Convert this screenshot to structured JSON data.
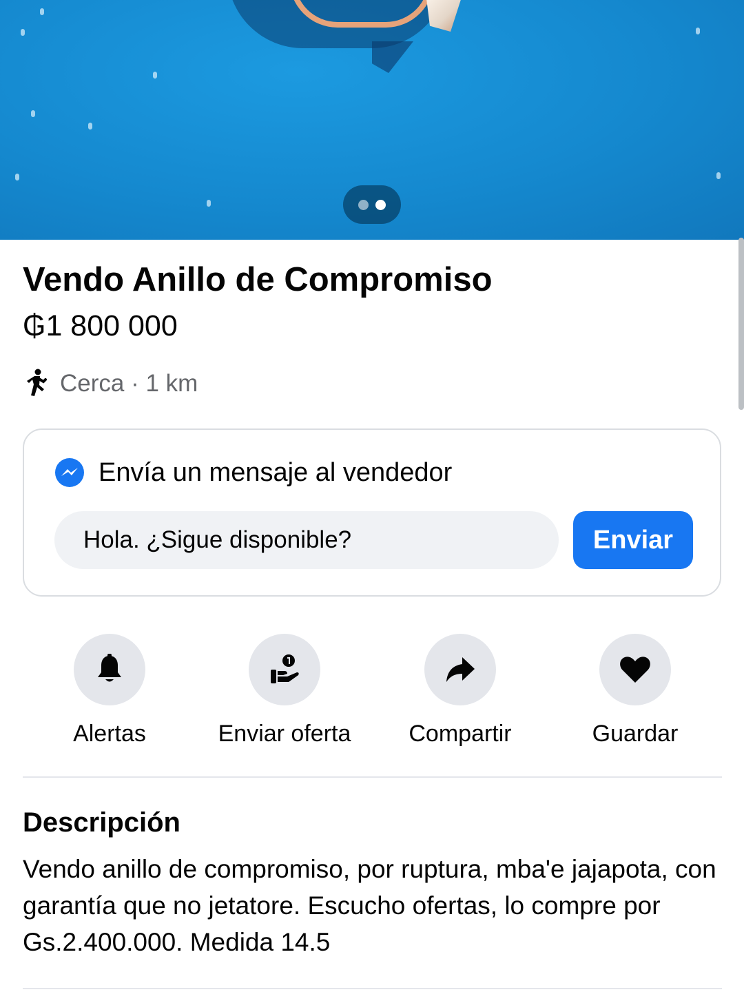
{
  "listing": {
    "title": "Vendo Anillo de Compromiso",
    "price": "₲1 800 000",
    "location": "Cerca · 1 km"
  },
  "gallery": {
    "image_count": 2,
    "active_index": 1
  },
  "message": {
    "heading": "Envía un mensaje al vendedor",
    "input_value": "Hola. ¿Sigue disponible?",
    "send_label": "Enviar"
  },
  "actions": [
    {
      "label": "Alertas",
      "icon": "bell-icon"
    },
    {
      "label": "Enviar oferta",
      "icon": "offer-icon"
    },
    {
      "label": "Compartir",
      "icon": "share-icon"
    },
    {
      "label": "Guardar",
      "icon": "heart-icon"
    }
  ],
  "description": {
    "heading": "Descripción",
    "body": "Vendo anillo de compromiso, por ruptura, mba'e jajapota, con garantía que no jetatore. Escucho ofertas, lo compre por Gs.2.400.000. Medida 14.5"
  },
  "colors": {
    "accent": "#1877f2",
    "icon_bg": "#e4e6eb",
    "input_bg": "#f0f2f5",
    "secondary_text": "#65676b"
  }
}
